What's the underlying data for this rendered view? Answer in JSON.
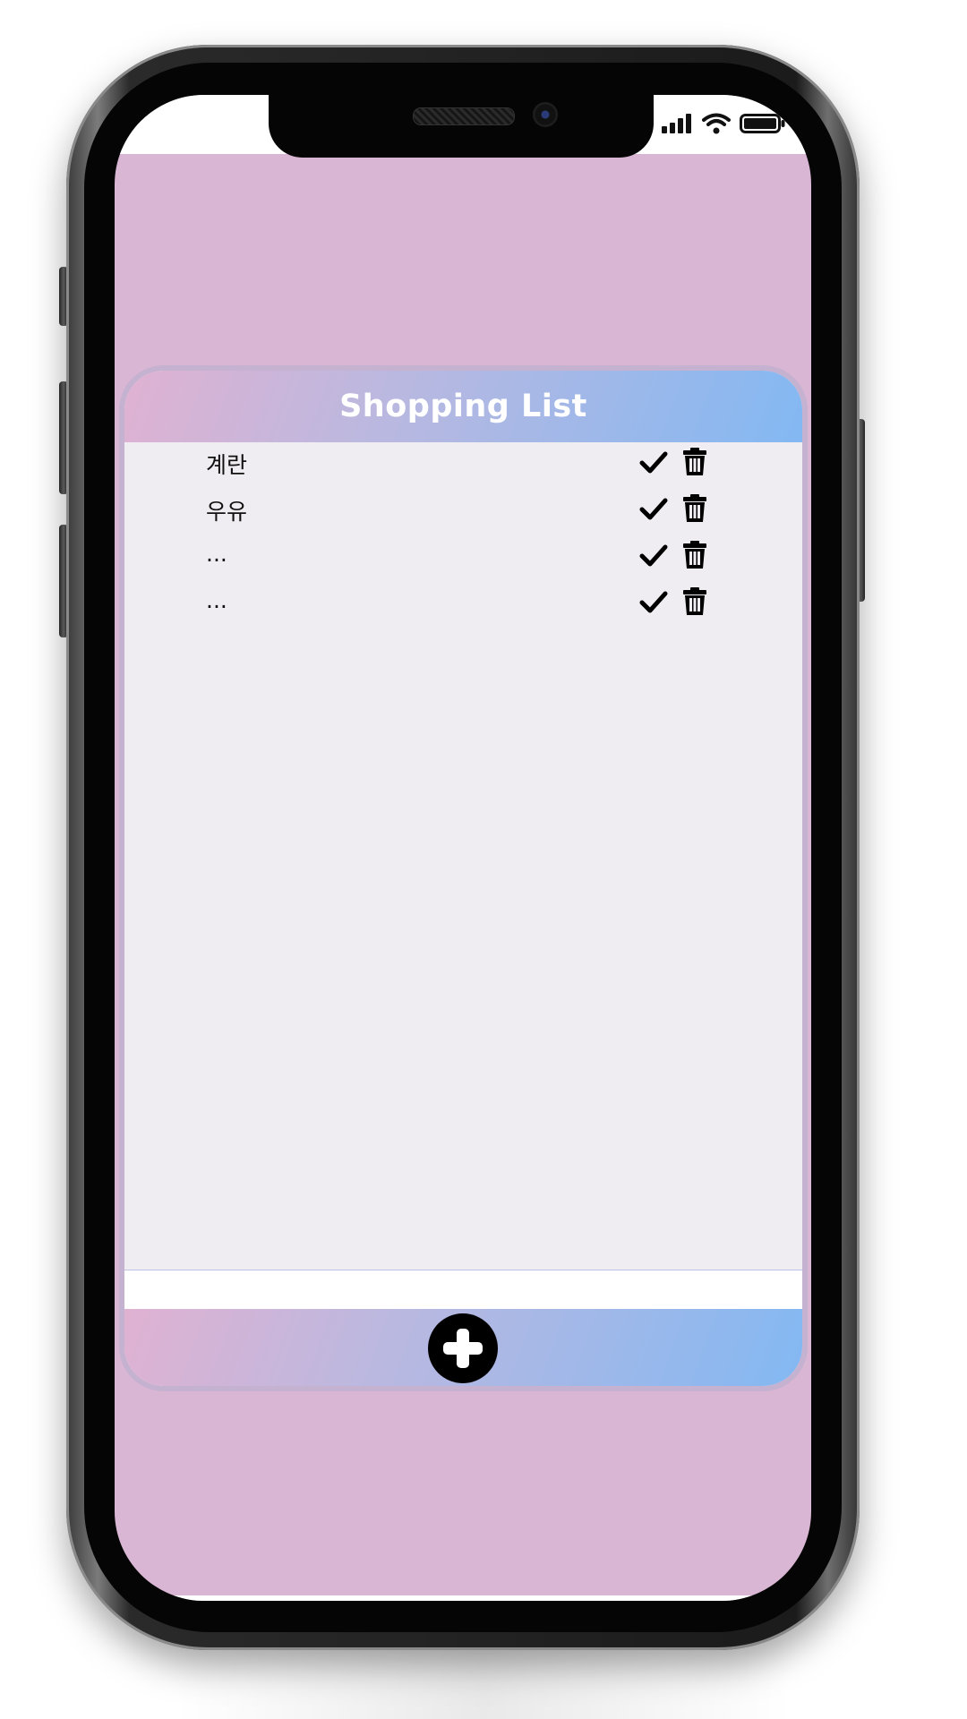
{
  "app": {
    "title": "Shopping List"
  },
  "items": [
    {
      "label": "계란"
    },
    {
      "label": "우유"
    },
    {
      "label": "..."
    },
    {
      "label": "..."
    }
  ],
  "item_actions": {
    "done_icon": "check-icon",
    "delete_icon": "trash-icon"
  },
  "new_item": {
    "value": "",
    "placeholder": ""
  },
  "footer": {
    "add_icon": "plus-circle-icon"
  },
  "status_bar": {
    "icons": [
      "signal-icon",
      "wifi-icon",
      "battery-icon"
    ]
  },
  "colors": {
    "screen_background": "#d9b6d4",
    "list_background": "#efedf2",
    "gradient_start": "#e0b2d2",
    "gradient_mid": "#b9b8e0",
    "gradient_end": "#83b8f2",
    "title_text": "#ffffff",
    "icon": "#000000"
  }
}
